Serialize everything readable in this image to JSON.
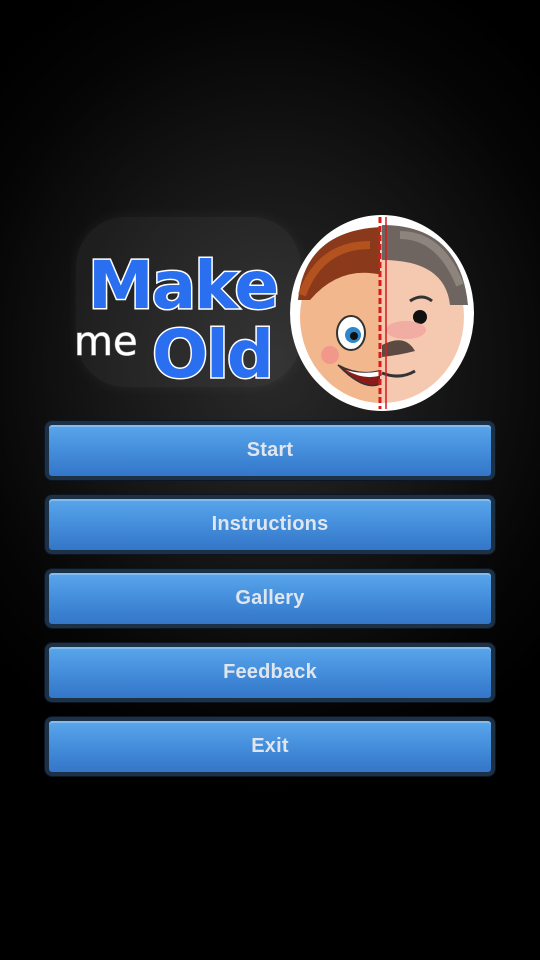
{
  "logo": {
    "word_make": "Make",
    "word_me": "me",
    "word_old": "Old",
    "mascot": "half-young-half-old-face-icon"
  },
  "menu": {
    "items": [
      {
        "label": "Start"
      },
      {
        "label": "Instructions"
      },
      {
        "label": "Gallery"
      },
      {
        "label": "Feedback"
      },
      {
        "label": "Exit"
      }
    ]
  },
  "colors": {
    "button_blue": "#4690dd",
    "button_border": "#1c3046",
    "logo_blue": "#2a6ff0",
    "background": "#000000"
  }
}
